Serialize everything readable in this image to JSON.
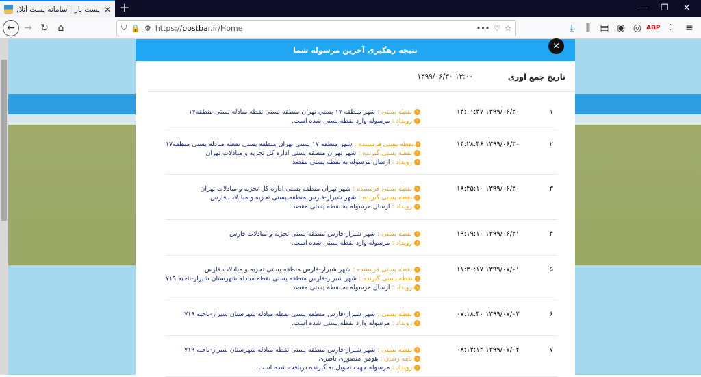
{
  "browser": {
    "tab_title": "پست بار | سامانه پست آنلاین کشور",
    "url_prefix": "https://",
    "url_domain": "postbar.ir",
    "url_path": "/Home"
  },
  "modal": {
    "title": "نتیجه رهگیری آخرین مرسوله شما",
    "collect_label": "تاریخ جمع آوری",
    "collect_value": "۱۳:۰۰ ۱۳۹۹/۰۶/۳۰"
  },
  "rows": [
    {
      "num": "۱",
      "dt": "۱۴:۰۱:۴۷ ۱۳۹۹/۰۶/۳۰",
      "lines": [
        {
          "k": "نقطه پستی",
          "v": "شهر منطقه ۱۷ پستي تهران منطقه پستی نقطه مبادله پستی منطقه۱۷"
        },
        {
          "k": "رویداد",
          "v": "مرسوله وارد نقطه پستی شده است."
        }
      ]
    },
    {
      "num": "۲",
      "dt": "۱۴:۲۸:۴۶ ۱۳۹۹/۰۶/۳۰",
      "lines": [
        {
          "k": "نقطه پستی فرستنده",
          "v": "شهر منطقه ۱۷ پستي تهران منطقه پستی نقطه مبادله پستی منطقه۱۷"
        },
        {
          "k": "نقطه پستی گیرنده",
          "v": "شهر تهران منطقه پستی اداره کل تجزیه و مبادلات تهران"
        },
        {
          "k": "رویداد",
          "v": "ارسال مرسوله به نقطه پستی مقصد"
        }
      ]
    },
    {
      "num": "۳",
      "dt": "۱۸:۴۵:۱۰ ۱۳۹۹/۰۶/۳۰",
      "lines": [
        {
          "k": "نقطه پستی فرستنده",
          "v": "شهر تهران منطقه پستی اداره کل تجزیه و مبادلات تهران"
        },
        {
          "k": "نقطه پستی گیرنده",
          "v": "شهر شیراز-فارس منطقه پستی تجزیه و مبادلات فارس"
        },
        {
          "k": "رویداد",
          "v": "ارسال مرسوله به نقطه پستی مقصد"
        }
      ]
    },
    {
      "num": "۴",
      "dt": "۱۹:۱۹:۱۰ ۱۳۹۹/۰۶/۳۱",
      "lines": [
        {
          "k": "نقطه پستی",
          "v": "شهر شیراز-فارس منطقه پستی تجزیه و مبادلات فارس"
        },
        {
          "k": "رویداد",
          "v": "مرسوله وارد نقطه پستی شده است."
        }
      ]
    },
    {
      "num": "۵",
      "dt": "۱۱:۳۰:۱۷ ۱۳۹۹/۰۷/۰۱",
      "lines": [
        {
          "k": "نقطه پستی فرستنده",
          "v": "شهر شیراز-فارس منطقه پستی تجزیه و مبادلات فارس"
        },
        {
          "k": "نقطه پستی گیرنده",
          "v": "شهر شیراز-فارس منطقه پستی نقطه مبادله شهرستان شیراز-ناحیه ۷۱۹"
        },
        {
          "k": "رویداد",
          "v": "ارسال مرسوله به نقطه پستی مقصد"
        }
      ]
    },
    {
      "num": "۶",
      "dt": "۰۷:۱۸:۴۰ ۱۳۹۹/۰۷/۰۲",
      "lines": [
        {
          "k": "نقطه پستی",
          "v": "شهر شیراز-فارس منطقه پستی نقطه مبادله شهرستان شیراز-ناحیه ۷۱۹"
        },
        {
          "k": "رویداد",
          "v": "مرسوله وارد نقطه پستی شده است."
        }
      ]
    },
    {
      "num": "۷",
      "dt": "۰۸:۱۴:۱۲ ۱۳۹۹/۰۷/۰۲",
      "lines": [
        {
          "k": "نقطه پستی",
          "v": "شهر شیراز-فارس منطقه پستی نقطه مبادله شهرستان شیراز-ناحیه ۷۱۹"
        },
        {
          "k": "نامه رسان",
          "v": "هومن منصوری باصری"
        },
        {
          "k": "رویداد",
          "v": "مرسوله جهت تحویل به گیرنده دریافت شده است."
        }
      ]
    }
  ]
}
